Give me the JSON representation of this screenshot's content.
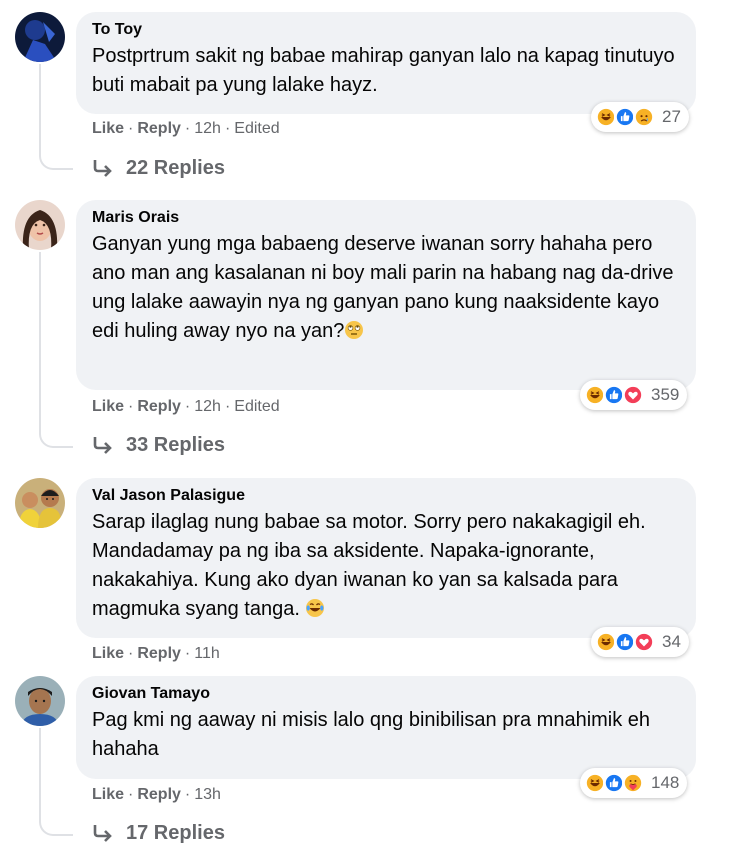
{
  "comments": [
    {
      "author": "To Toy",
      "text": "Postprtrum sakit ng babae mahirap ganyan lalo na kapag tinutuyo buti mabait pa yung lalake hayz.",
      "reaction_count": "27",
      "reactions": [
        "haha",
        "like",
        "sad"
      ],
      "like_label": "Like",
      "reply_label": "Reply",
      "time": "12h",
      "edited": "Edited",
      "replies": "22 Replies"
    },
    {
      "author": "Maris Orais",
      "text": "Ganyan yung mga babaeng deserve iwanan sorry hahaha pero ano man ang kasalanan ni boy mali parin na habang nag da-drive ung lalake aawayin nya ng ganyan pano kung naaksidente kayo edi huling away nyo na yan?",
      "emoji": "eye-roll",
      "reaction_count": "359",
      "reactions": [
        "haha",
        "like",
        "love"
      ],
      "like_label": "Like",
      "reply_label": "Reply",
      "time": "12h",
      "edited": "Edited",
      "replies": "33 Replies"
    },
    {
      "author": "Val Jason Palasigue",
      "text": "Sarap ilaglag nung babae sa motor. Sorry pero nakakagigil eh. Mandadamay pa ng iba sa aksidente. Napaka-ignorante, nakakahiya. Kung ako dyan iwanan ko yan sa kalsada para magmuka syang tanga.",
      "emoji": "tears-of-joy",
      "reaction_count": "34",
      "reactions": [
        "haha",
        "like",
        "love"
      ],
      "like_label": "Like",
      "reply_label": "Reply",
      "time": "11h"
    },
    {
      "author": "Giovan Tamayo",
      "text": "Pag kmi ng aaway ni misis lalo qng binibilisan pra mnahimik eh hahaha",
      "reaction_count": "148",
      "reactions": [
        "haha",
        "like",
        "care"
      ],
      "like_label": "Like",
      "reply_label": "Reply",
      "time": "13h",
      "replies": "17 Replies"
    }
  ],
  "colors": {
    "bubble": "#f0f2f5",
    "secondary_text": "#65676b",
    "like_blue": "#1877f2",
    "love_red": "#f33e58",
    "haha_yellow": "#f7b125"
  }
}
